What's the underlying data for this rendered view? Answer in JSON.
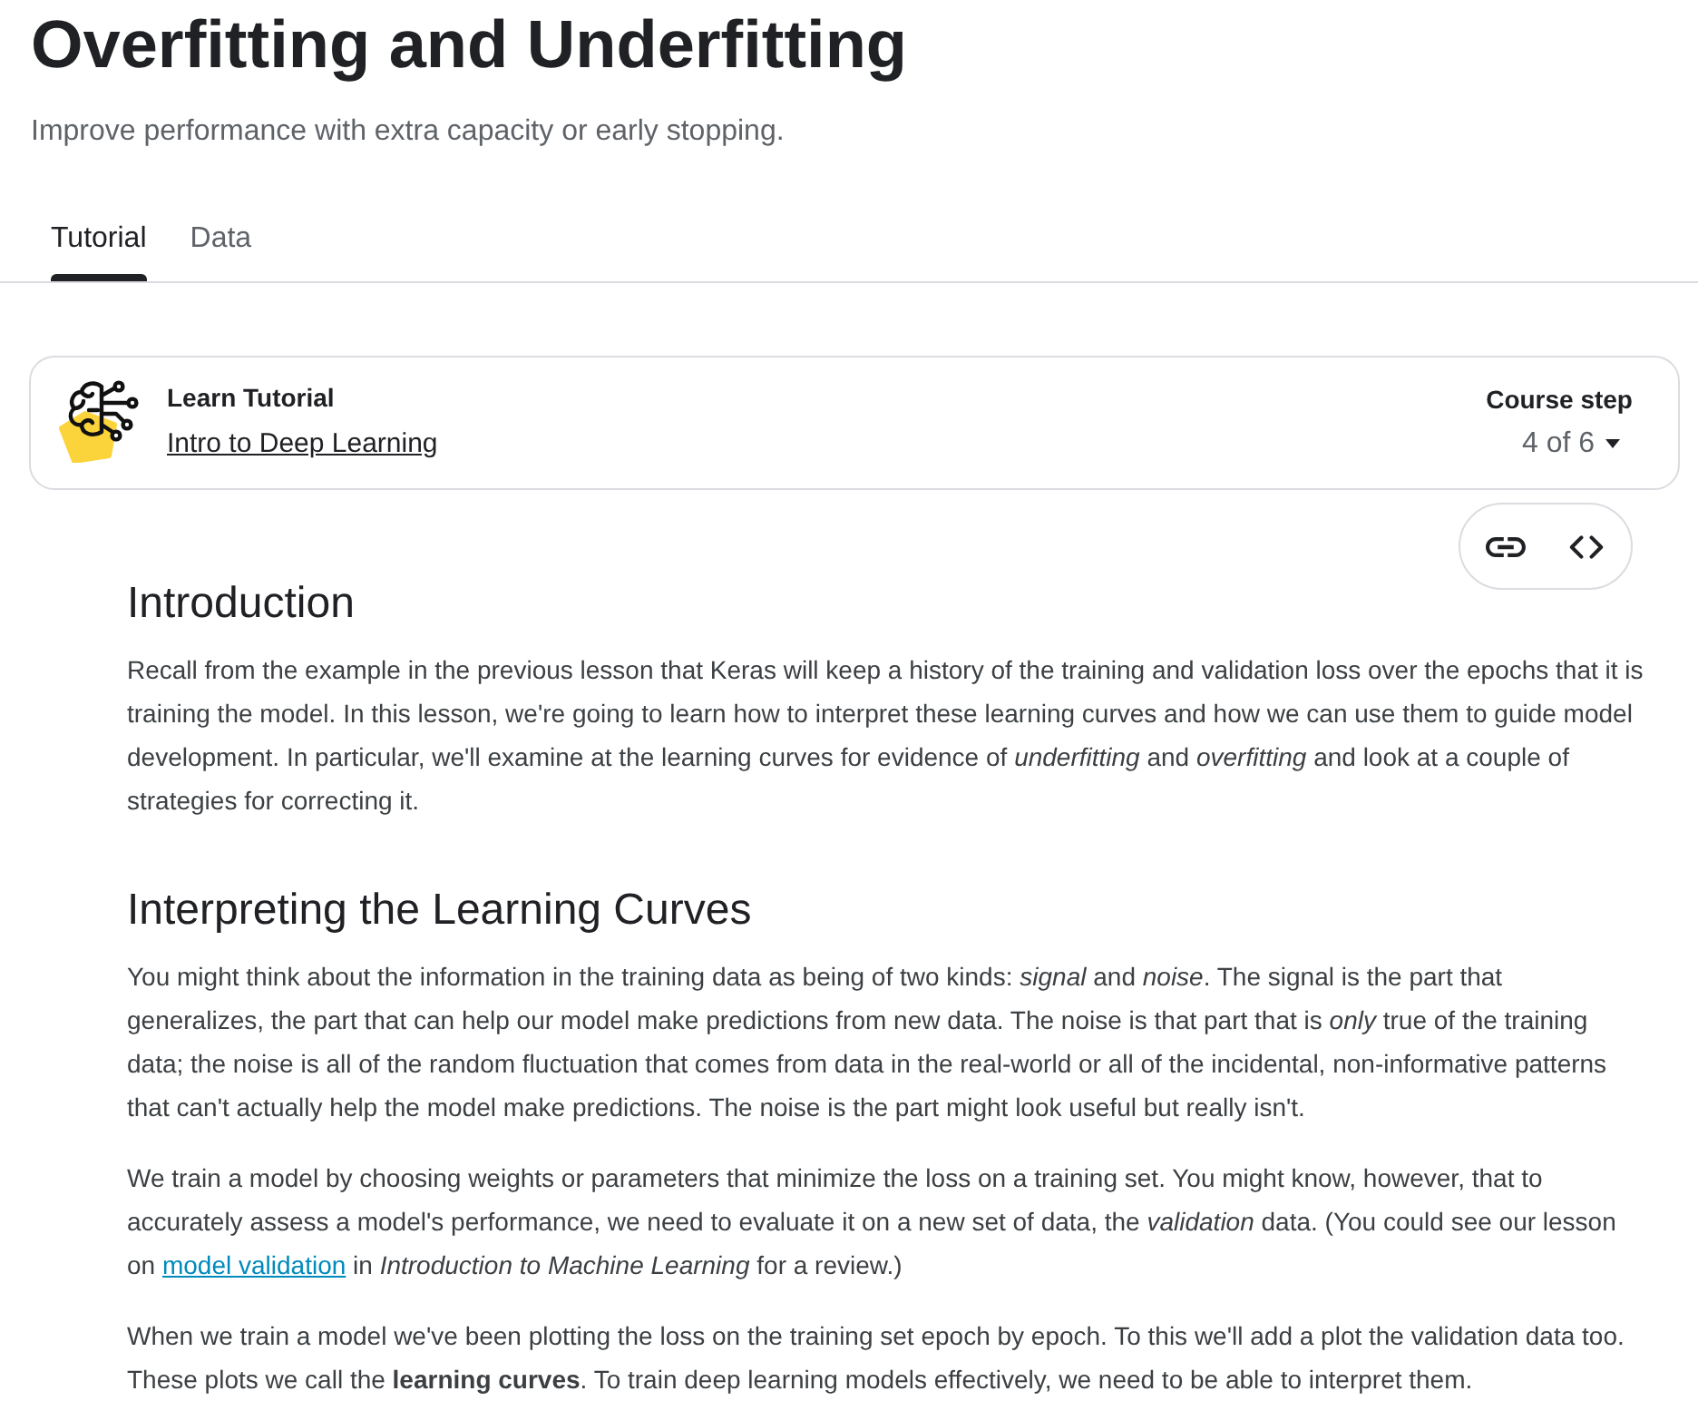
{
  "header": {
    "title": "Overfitting and Underfitting",
    "subtitle": "Improve performance with extra capacity or early stopping."
  },
  "tabs": [
    {
      "label": "Tutorial",
      "selected": true
    },
    {
      "label": "Data",
      "selected": false
    }
  ],
  "tutorial_card": {
    "label": "Learn Tutorial",
    "course": "Intro to Deep Learning",
    "step_label": "Course step",
    "step": "4 of 6"
  },
  "sections": [
    {
      "heading": "Introduction",
      "paragraphs": [
        {
          "segments": [
            {
              "kind": "text",
              "text": "Recall from the example in the previous lesson that Keras will keep a history of the training and validation loss over the epochs that it is training the model. In this lesson, we're going to learn how to interpret these learning curves and how we can use them to guide model development. In particular, we'll examine at the learning curves for evidence of *underfitting* and *overfitting* and look at a couple of strategies for correcting it."
            }
          ]
        }
      ]
    },
    {
      "heading": "Interpreting the Learning Curves",
      "paragraphs": [
        {
          "segments": [
            {
              "kind": "text",
              "text": "You might think about the information in the training data as being of two kinds: *signal* and *noise*. The signal is the part that generalizes, the part that can help our model make predictions from new data. The noise is that part that is *only* true of the training data; the noise is all of the random fluctuation that comes from data in the real-world or all of the incidental, non-informative patterns that can't actually help the model make predictions. The noise is the part might look useful but really isn't."
            }
          ]
        },
        {
          "segments": [
            {
              "kind": "text",
              "text": "We train a model by choosing weights or parameters that minimize the loss on a training set. You might know, however, that to accurately assess a model's performance, we need to evaluate it on a new set of data, the *validation* data. (You could see our lesson on "
            },
            {
              "kind": "link",
              "text": "model validation"
            },
            {
              "kind": "text",
              "text": " in *Introduction to Machine Learning* for a review.)"
            }
          ]
        },
        {
          "segments": [
            {
              "kind": "text",
              "text": "When we train a model we've been plotting the loss on the training set epoch by epoch. To this we'll add a plot the validation data too. These plots we call the **learning curves**. To train deep learning models effectively, we need to be able to interpret them."
            }
          ]
        }
      ]
    }
  ]
}
